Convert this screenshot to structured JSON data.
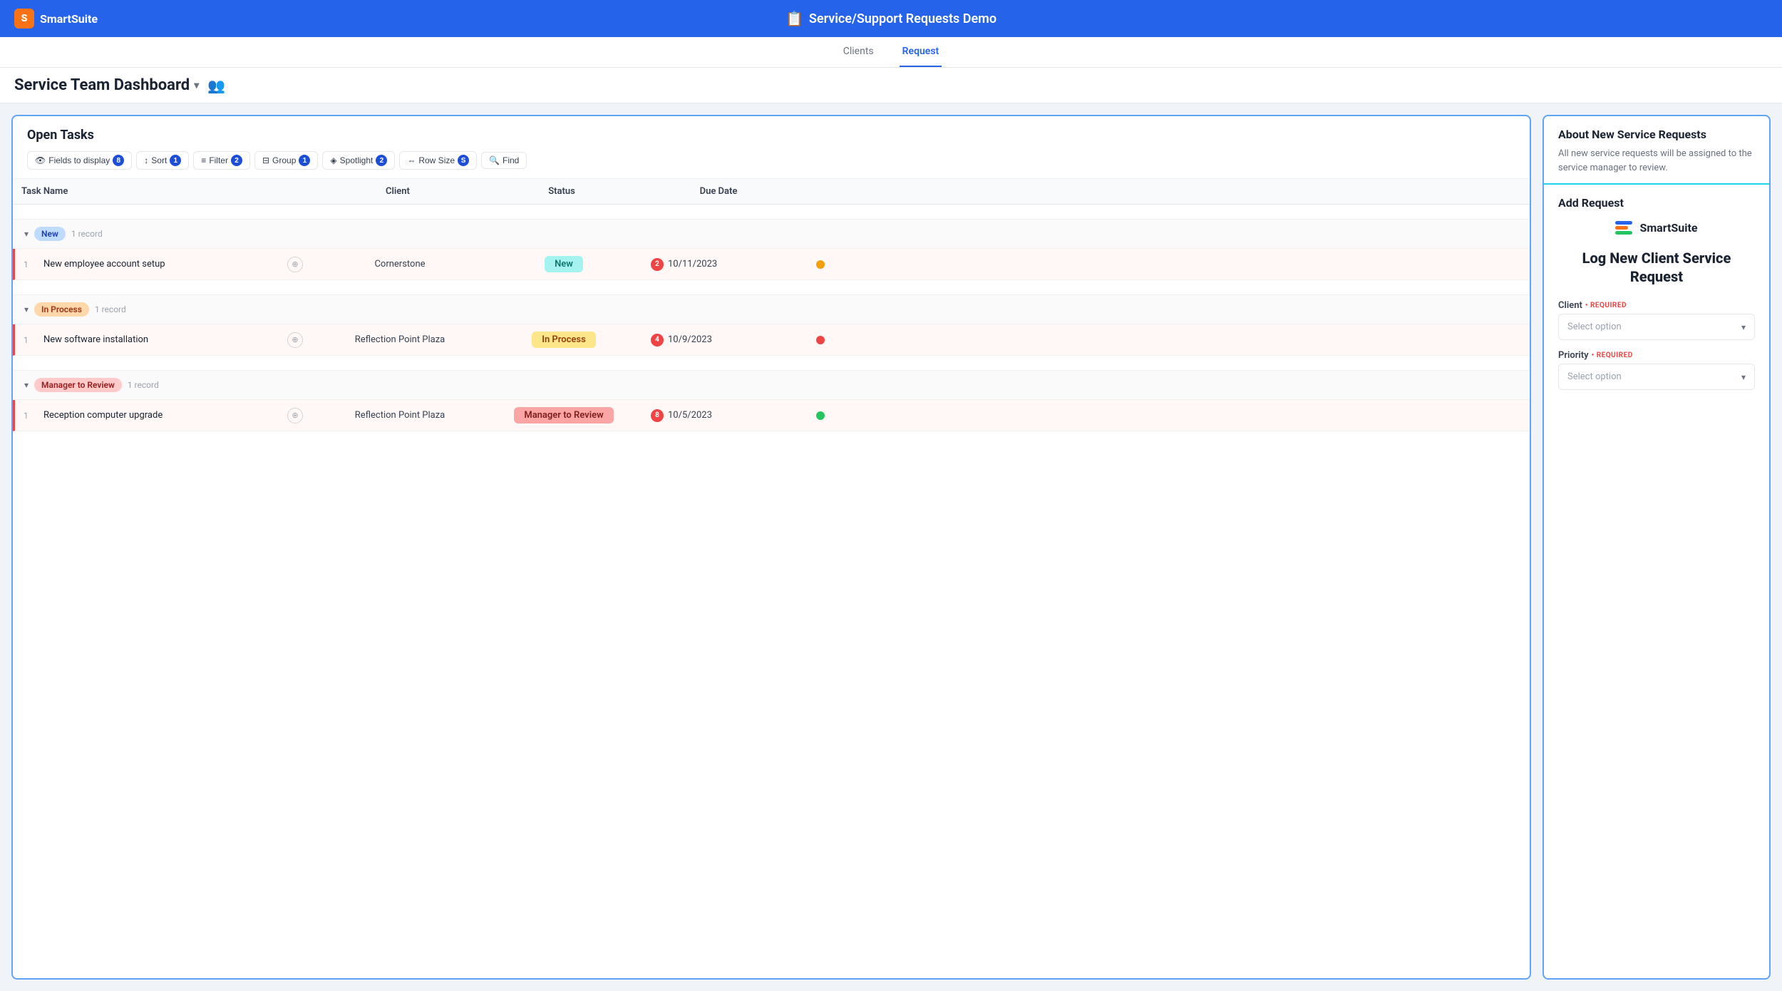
{
  "app": {
    "name": "SmartSuite",
    "logo_letter": "S"
  },
  "header": {
    "title": "Service/Support Requests Demo",
    "title_icon": "📋"
  },
  "subnav": {
    "items": [
      {
        "label": "Clients",
        "active": false
      },
      {
        "label": "Request",
        "active": true
      }
    ]
  },
  "dashboard": {
    "title": "Service Team Dashboard",
    "chevron": "▾",
    "team_icon": "👥"
  },
  "tasks_panel": {
    "title": "Open Tasks",
    "toolbar": [
      {
        "label": "Fields to display",
        "badge": "8",
        "icon": "👁"
      },
      {
        "label": "Sort",
        "badge": "1",
        "icon": "↕"
      },
      {
        "label": "Filter",
        "badge": "2",
        "icon": "≡"
      },
      {
        "label": "Group",
        "badge": "1",
        "icon": "⊟"
      },
      {
        "label": "Spotlight",
        "badge": "2",
        "icon": "◈"
      },
      {
        "label": "Row Size",
        "badge": "S",
        "icon": "⇔"
      },
      {
        "label": "Find",
        "badge": null,
        "icon": "🔍"
      }
    ],
    "columns": [
      "Task Name",
      "",
      "Client",
      "Status",
      "Due Date",
      ""
    ],
    "groups": [
      {
        "name": "New",
        "badge_class": "new",
        "record_count": "1 record",
        "rows": [
          {
            "num": 1,
            "task_name": "New employee account setup",
            "client": "Cornerstone",
            "status": "New",
            "status_class": "new",
            "due_date": "10/11/2023",
            "date_badge": "2",
            "dot_class": "yellow"
          }
        ]
      },
      {
        "name": "In Process",
        "badge_class": "in-process",
        "record_count": "1 record",
        "rows": [
          {
            "num": 1,
            "task_name": "New software installation",
            "client": "Reflection Point Plaza",
            "status": "In Process",
            "status_class": "in-process",
            "due_date": "10/9/2023",
            "date_badge": "4",
            "dot_class": "red"
          }
        ]
      },
      {
        "name": "Manager to Review",
        "badge_class": "manager",
        "record_count": "1 record",
        "rows": [
          {
            "num": 1,
            "task_name": "Reception computer upgrade",
            "client": "Reflection Point Plaza",
            "status": "Manager to Review",
            "status_class": "manager",
            "due_date": "10/5/2023",
            "date_badge": "8",
            "dot_class": "green"
          }
        ]
      }
    ]
  },
  "right_panel": {
    "header_title": "About New Service Requests",
    "header_desc": "All new service requests will be assigned to the service manager to review.",
    "add_request_title": "Add Request",
    "ss_logo_text": "SmartSuite",
    "form_cta": "Log New Client Service Request",
    "fields": [
      {
        "label": "Client",
        "required": true,
        "required_label": "REQUIRED",
        "placeholder": "Select option"
      },
      {
        "label": "Priority",
        "required": true,
        "required_label": "REQUIRED",
        "placeholder": "Select option"
      }
    ]
  }
}
